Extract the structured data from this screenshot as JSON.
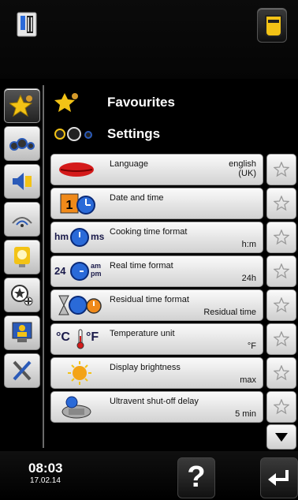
{
  "header": {
    "left_icon": "oven-device-icon",
    "right_icon": "cleaning-tab-icon"
  },
  "sidebar": {
    "items": [
      {
        "icon": "favourites-star-icon",
        "active": true
      },
      {
        "icon": "settings-dials-icon",
        "active": false
      },
      {
        "icon": "volume-speaker-icon",
        "active": false
      },
      {
        "icon": "wifi-signal-icon",
        "active": false
      },
      {
        "icon": "light-bulb-icon",
        "active": false
      },
      {
        "icon": "profile-add-icon",
        "active": false
      },
      {
        "icon": "monitor-user-icon",
        "active": false
      },
      {
        "icon": "service-tools-icon",
        "active": false
      }
    ]
  },
  "sections": {
    "favourites_label": "Favourites",
    "settings_label": "Settings"
  },
  "settings": [
    {
      "title": "Language",
      "value_line1": "english",
      "value_line2": "(UK)",
      "icon": "lips-icon"
    },
    {
      "title": "Date and time",
      "value_line1": "",
      "value_line2": "",
      "icon": "calendar-clock-icon"
    },
    {
      "title": "Cooking time format",
      "value_line1": "h:m",
      "value_line2": "",
      "icon": "hm-ms-clock-icon",
      "icon_left_text": "hm",
      "icon_right_text": "ms"
    },
    {
      "title": "Real time format",
      "value_line1": "24h",
      "value_line2": "",
      "icon": "24-ampm-clock-icon",
      "icon_left_text": "24",
      "icon_right_text": "am pm"
    },
    {
      "title": "Residual time format",
      "value_line1": "Residual time",
      "value_line2": "",
      "icon": "hourglass-clock-icon"
    },
    {
      "title": "Temperature unit",
      "value_line1": "°F",
      "value_line2": "",
      "icon": "thermometer-icon",
      "icon_left_text": "°C",
      "icon_right_text": "°F"
    },
    {
      "title": "Display brightness",
      "value_line1": "max",
      "value_line2": "",
      "icon": "sun-brightness-icon"
    },
    {
      "title": "Ultravent shut-off delay",
      "value_line1": "5 min",
      "value_line2": "",
      "icon": "ultravent-icon"
    }
  ],
  "footer": {
    "time": "08:03",
    "date": "17.02.14",
    "help_label": "?",
    "back_icon": "return-arrow-icon"
  },
  "colors": {
    "background": "#000000",
    "accent_yellow": "#f3c316",
    "row_light": "#fafafa"
  }
}
